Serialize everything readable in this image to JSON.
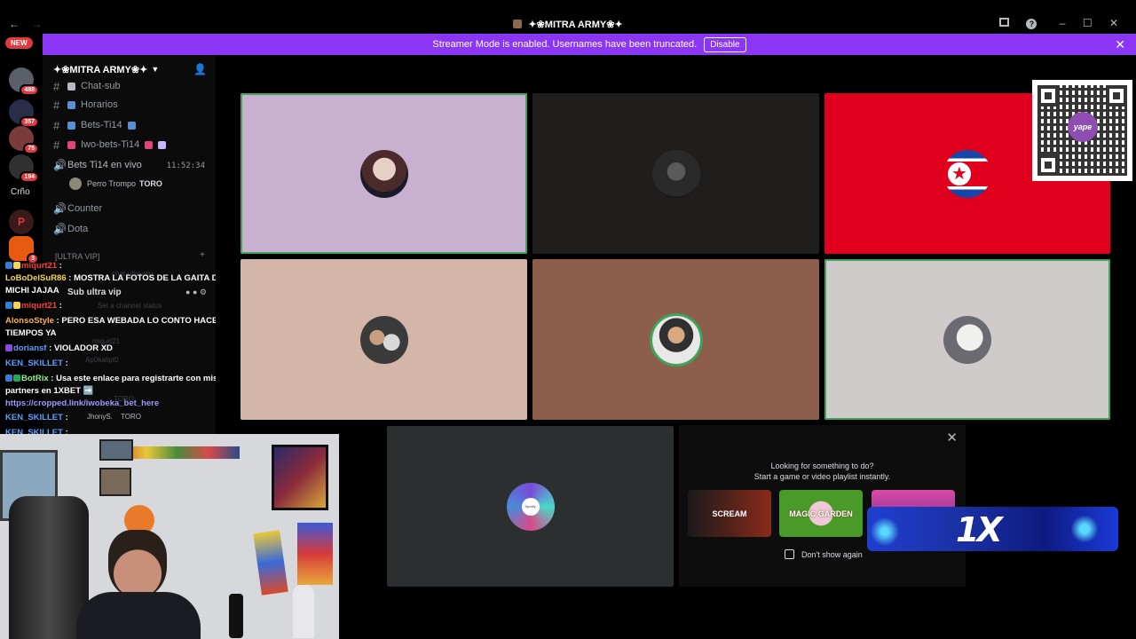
{
  "titlebar": {
    "back_glyph": "←",
    "forward_glyph": "→",
    "title": "✦❀MITRA ARMY❀✦",
    "icons": [
      "inbox-icon",
      "help-icon",
      "minimize-icon",
      "maximize-icon",
      "close-icon"
    ]
  },
  "banner": {
    "text": "Streamer Mode is enabled. Usernames have been truncated.",
    "disable_label": "Disable",
    "color": "#8b36f5"
  },
  "rail": {
    "new_label": "NEW",
    "badges": [
      "488",
      "357",
      "75",
      "194"
    ],
    "text_server": "Crño",
    "badge_bottom": "3"
  },
  "sidebar": {
    "server_name": "✦❀MITRA ARMY❀✦",
    "channels": [
      {
        "name": "Chat-sub"
      },
      {
        "name": "Horarios"
      },
      {
        "name": "Bets-Ti14"
      },
      {
        "name": "Iwo-bets-Ti14"
      }
    ],
    "live_channel": {
      "name": "Bets Ti14 en vivo",
      "time": "11:52:34"
    },
    "member": {
      "name": "Perro Trompo",
      "tag": "TORO"
    },
    "voice_channels": [
      "Counter",
      "Dota"
    ],
    "category": "[ULTRA VIP]",
    "sub_channel": "Sub ultra vip",
    "faint": {
      "chat_ultra_vip": "chat-ultra-vip",
      "status": "Set a channel status",
      "m1": "miqurt21",
      "m2": "Ap0kalipt0",
      "m3": "TORO",
      "m4": "JhonyS.",
      "m5": "TORO"
    }
  },
  "chat": {
    "lines": [
      {
        "user": "miqurt21",
        "sep": " : "
      },
      {
        "user": "LoBoDelSuR86",
        "sep": " : ",
        "text": "MOSTRA LA FOTOS DE LA GAITA DEL"
      },
      {
        "text": "MICHI JAJAA"
      },
      {
        "user": "miqurt21",
        "sep": " : "
      },
      {
        "user": "AlonsoStyle",
        "sep": " : ",
        "text": "PERO ESA WEBADA LO CONTO HACE"
      },
      {
        "text": "TIEMPOS YA"
      },
      {
        "user": "doriansf",
        "sep": " : ",
        "text": "VIOLADOR XD"
      },
      {
        "user": "KEN_SKILLET",
        "sep": " : "
      },
      {
        "user": "BotRix",
        "sep": " : ",
        "text": "Usa este enlace para registrarte con mis"
      },
      {
        "text": "partners en 1XBET ➡️"
      },
      {
        "text": "https://cropped.link/iwobeka_bet_here"
      },
      {
        "user": "KEN_SKILLET",
        "sep": " : "
      },
      {
        "user": "KEN_SKILLET",
        "sep": " : "
      }
    ]
  },
  "stage": {
    "tiles": [
      {
        "bg": "#c9b0d0",
        "speaking": true,
        "avatar": "anime"
      },
      {
        "bg": "#201e1c",
        "speaking": false,
        "avatar": "dark"
      },
      {
        "bg": "#e0001e",
        "speaking": false,
        "avatar": "flag"
      },
      {
        "bg": "#d3b6a8",
        "speaking": false,
        "avatar": "photo"
      },
      {
        "bg": "#8e5e4c",
        "speaking": false,
        "avatar": "green"
      },
      {
        "bg": "#d0cbcb",
        "speaking": true,
        "avatar": "cat"
      },
      {
        "bg": "#2c2f30",
        "speaking": false,
        "avatar": "vinyl"
      }
    ],
    "vinyl_label": "Spotify"
  },
  "qr": {
    "brand": "yape"
  },
  "popup": {
    "title": "Looking for something to do?",
    "subtitle": "Start a game or video playlist instantly.",
    "games": [
      "SCREAM",
      "MAGIC GARDEN",
      ""
    ],
    "checkbox_label": "Don't show again"
  },
  "ad": {
    "logo": "1X"
  }
}
